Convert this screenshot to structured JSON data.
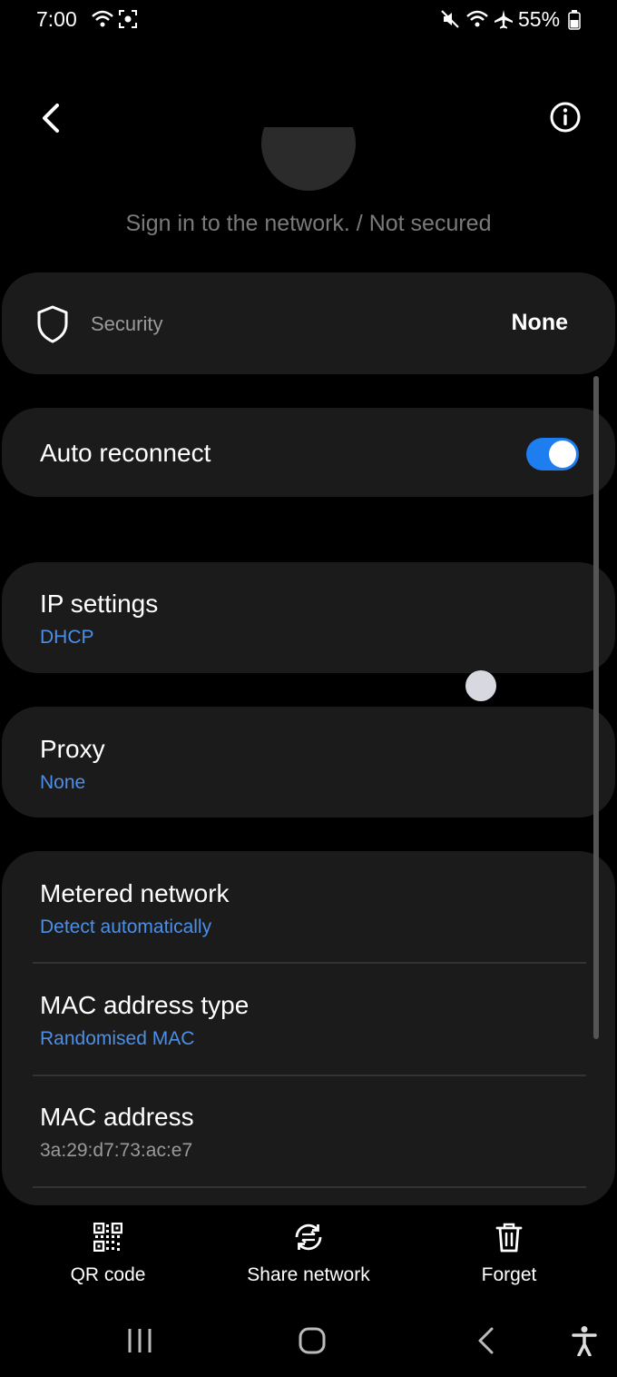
{
  "status_bar": {
    "time": "7:00",
    "battery": "55%"
  },
  "header": {
    "subtitle": "Sign in to the network. / Not secured"
  },
  "security": {
    "label": "Security",
    "value": "None"
  },
  "auto_reconnect": {
    "label": "Auto reconnect",
    "enabled": true
  },
  "ip_settings": {
    "title": "IP settings",
    "value": "DHCP"
  },
  "proxy": {
    "title": "Proxy",
    "value": "None"
  },
  "advanced": {
    "metered": {
      "title": "Metered network",
      "value": "Detect automatically"
    },
    "mac_type": {
      "title": "MAC address type",
      "value": "Randomised MAC"
    },
    "mac_address": {
      "title": "MAC address",
      "value": "3a:29:d7:73:ac:e7"
    }
  },
  "actions": [
    {
      "label": "QR code",
      "icon": "qr-code-icon"
    },
    {
      "label": "Share network",
      "icon": "share-network-icon"
    },
    {
      "label": "Forget",
      "icon": "trash-icon"
    }
  ],
  "colors": {
    "accent": "#4d8fe6",
    "toggle_on": "#1e7ef0",
    "card_bg": "#1b1b1b"
  }
}
